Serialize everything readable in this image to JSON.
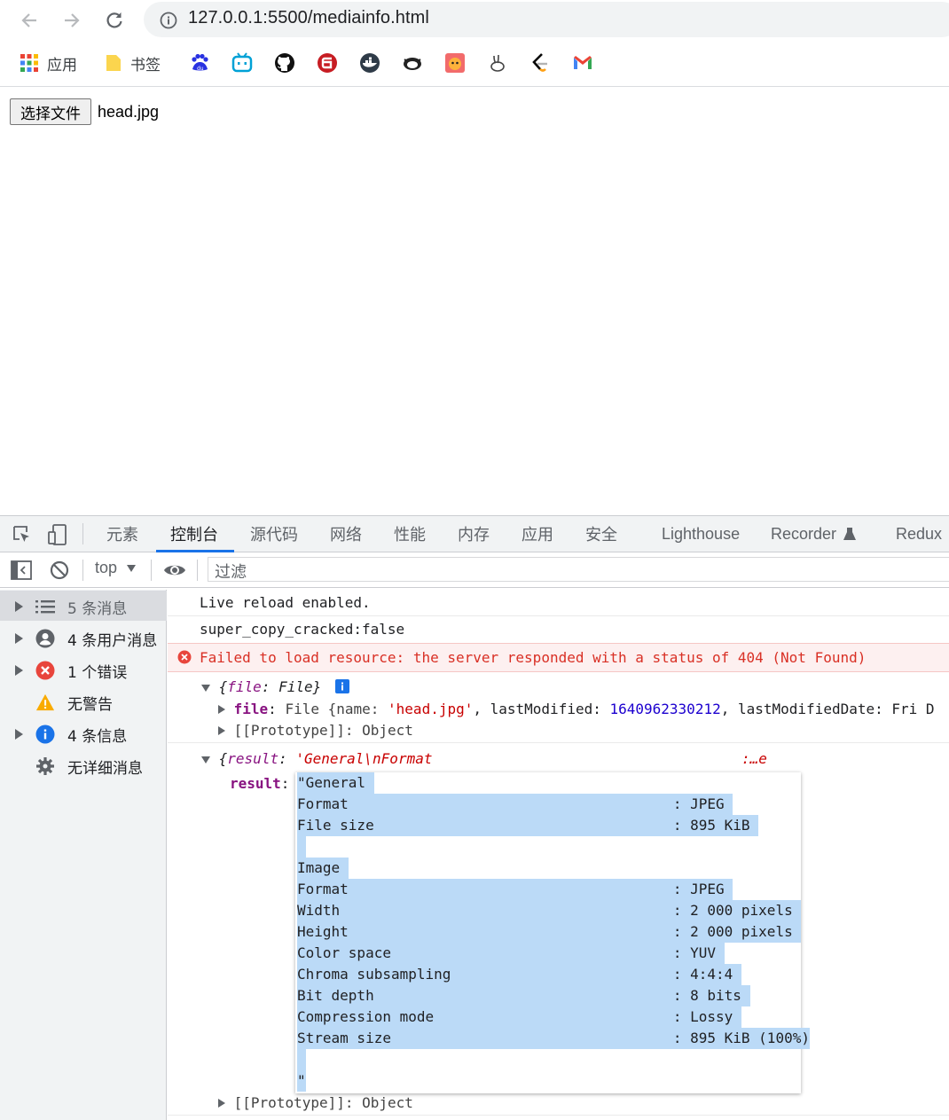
{
  "browser": {
    "url": "127.0.0.1:5500/mediainfo.html",
    "bookmarks": [
      {
        "label": "应用",
        "icon": "apps-grid-icon"
      },
      {
        "label": "书签",
        "icon": "folder-icon"
      },
      {
        "label": "",
        "icon": "baidu-icon"
      },
      {
        "label": "",
        "icon": "bilibili-icon"
      },
      {
        "label": "",
        "icon": "github-icon"
      },
      {
        "label": "",
        "icon": "gitee-icon"
      },
      {
        "label": "",
        "icon": "docker-icon"
      },
      {
        "label": "",
        "icon": "niuke-icon"
      },
      {
        "label": "",
        "icon": "tiger-icon"
      },
      {
        "label": "",
        "icon": "rabbit-icon"
      },
      {
        "label": "",
        "icon": "leetcode-icon"
      },
      {
        "label": "",
        "icon": "gmail-icon"
      }
    ]
  },
  "page": {
    "file_button": "选择文件",
    "file_name": "head.jpg"
  },
  "devtools": {
    "tabs": [
      "元素",
      "控制台",
      "源代码",
      "网络",
      "性能",
      "内存",
      "应用",
      "安全",
      "Lighthouse",
      "Recorder",
      "Redux"
    ],
    "active_tab": "控制台",
    "context": "top",
    "filter_placeholder": "过滤",
    "sidebar": [
      {
        "label": "5 条消息",
        "icon": "list-icon"
      },
      {
        "label": "4 条用户消息",
        "icon": "user-icon"
      },
      {
        "label": "1 个错误",
        "icon": "error-icon"
      },
      {
        "label": "无警告",
        "icon": "warning-icon"
      },
      {
        "label": "4 条信息",
        "icon": "info-icon"
      },
      {
        "label": "无详细消息",
        "icon": "gear-icon"
      }
    ],
    "console": {
      "log1": "Live reload enabled.",
      "log2": "super_copy_cracked:false",
      "error": "Failed to load resource: the server responded with a status of 404 (Not Found)",
      "obj1_head_key": "file",
      "obj1_head_val": "File",
      "obj1_prop_key": "file",
      "obj1_prop_prefix": "File {name: ",
      "obj1_prop_name": "'head.jpg'",
      "obj1_prop_mid": ", lastModified: ",
      "obj1_prop_num": "1640962330212",
      "obj1_prop_tail": ", lastModifiedDate: Fri D",
      "obj1_proto": "[[Prototype]]: Object",
      "obj2_head_key": "result",
      "obj2_head_val": "'General\\nFormat",
      "obj2_head_tail": ":…e",
      "obj2_prop_key": "result",
      "obj2_proto": "[[Prototype]]: Object",
      "popup_lines": [
        "\"General ",
        "Format                                      : JPEG ",
        "File size                                   : 895 KiB ",
        " ",
        "Image ",
        "Format                                      : JPEG ",
        "Width                                       : 2 000 pixels ",
        "Height                                      : 2 000 pixels ",
        "Color space                                 : YUV ",
        "Chroma subsampling                          : 4:4:4 ",
        "Bit depth                                   : 8 bits ",
        "Compression mode                            : Lossy ",
        "Stream size                                 : 895 KiB (100%)",
        " ",
        "\""
      ]
    }
  }
}
